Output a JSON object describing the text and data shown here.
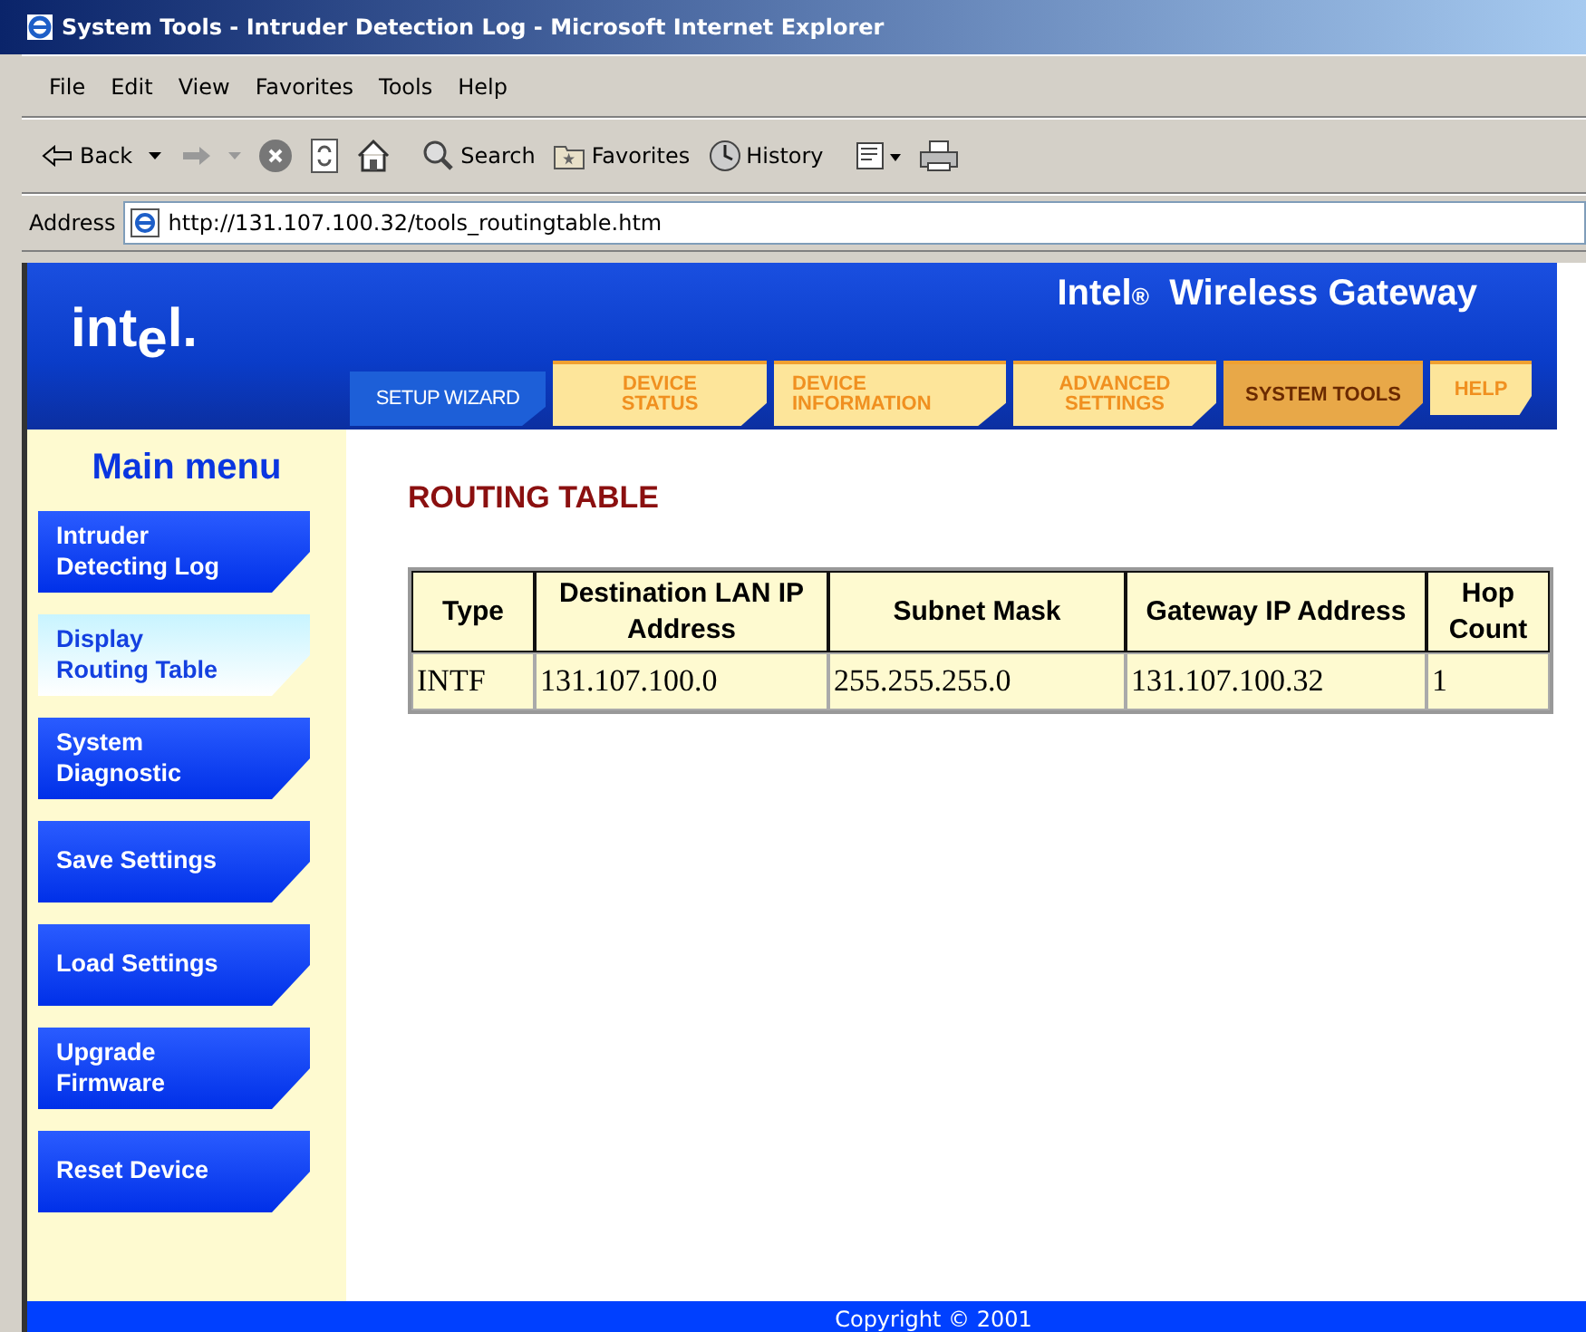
{
  "window": {
    "title": "System Tools - Intruder Detection Log - Microsoft Internet Explorer"
  },
  "menu_bar": [
    "File",
    "Edit",
    "View",
    "Favorites",
    "Tools",
    "Help"
  ],
  "toolbar": [
    {
      "kind": "back",
      "label": "Back"
    },
    {
      "kind": "forward"
    },
    {
      "kind": "stop"
    },
    {
      "kind": "refresh"
    },
    {
      "kind": "home"
    },
    {
      "kind": "search",
      "label": "Search"
    },
    {
      "kind": "favorites",
      "label": "Favorites"
    },
    {
      "kind": "history",
      "label": "History"
    },
    {
      "kind": "mail"
    },
    {
      "kind": "print"
    }
  ],
  "address_bar": {
    "label": "Address",
    "value": "http://131.107.100.32/tools_routingtable.htm"
  },
  "header": {
    "company": "Intel",
    "reg": "®",
    "brand": "Wireless Gateway",
    "logo": "int",
    "logo_e": "e",
    "logo_l": "l."
  },
  "tabs": [
    {
      "label": "SETUP WIZARD",
      "kind": "blue",
      "selected": false
    },
    {
      "label": "DEVICE STATUS",
      "kind": "orange",
      "selected": false
    },
    {
      "label": "DEVICE INFORMATION",
      "kind": "orange",
      "selected": false
    },
    {
      "label": "ADVANCED SETTINGS",
      "kind": "orange",
      "selected": false
    },
    {
      "label": "SYSTEM TOOLS",
      "kind": "orange",
      "selected": true
    },
    {
      "label": "HELP",
      "kind": "orange",
      "selected": false
    }
  ],
  "sidebar": {
    "title": "Main menu",
    "items": [
      {
        "label": "Intruder Detecting Log",
        "selected": false
      },
      {
        "label": "Display Routing Table",
        "selected": true
      },
      {
        "label": "System Diagnostic",
        "selected": false
      },
      {
        "label": "Save Settings",
        "selected": false
      },
      {
        "label": "Load Settings",
        "selected": false
      },
      {
        "label": "Upgrade Firmware",
        "selected": false
      },
      {
        "label": "Reset Device",
        "selected": false
      }
    ]
  },
  "content": {
    "heading": "ROUTING TABLE",
    "table": {
      "columns": [
        "Type",
        "Destination LAN IP Address",
        "Subnet Mask",
        "Gateway IP Address",
        "Hop Count"
      ],
      "rows": [
        [
          "INTF",
          "131.107.100.0",
          "255.255.255.0",
          "131.107.100.32",
          "1"
        ]
      ]
    }
  },
  "footer": {
    "text": "Copyright © 2001"
  }
}
